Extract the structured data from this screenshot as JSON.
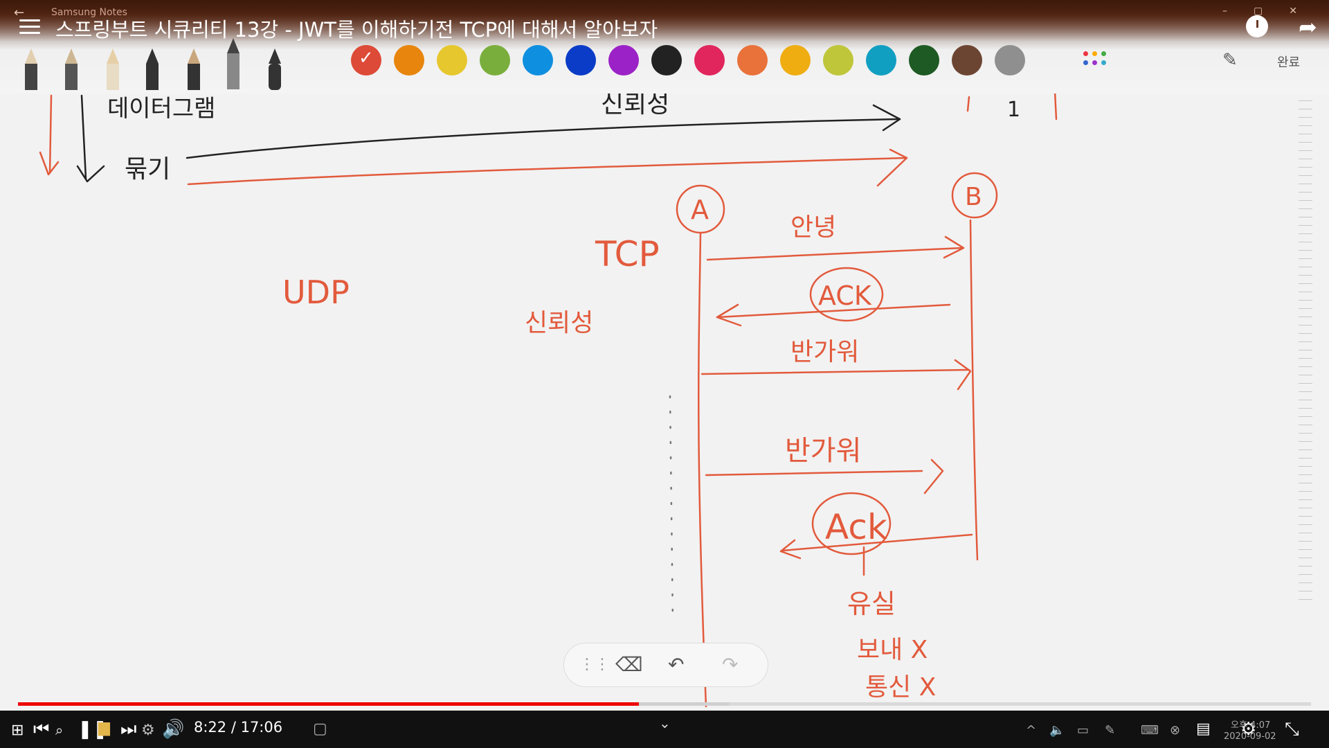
{
  "window": {
    "app_name": "Samsung Notes"
  },
  "video": {
    "title": "스프링부트 시큐리티 13강 - JWT를 이해하기전 TCP에 대해서 알아보자"
  },
  "toolbar": {
    "pens": [
      "pen-light",
      "pen-brush",
      "pen-pencil",
      "pen-fountain",
      "pen-ink",
      "pen-marker",
      "pen-custom"
    ],
    "colors": [
      "#dd4a37",
      "#e8850d",
      "#e6c72e",
      "#7aae3c",
      "#0f8fe0",
      "#0b3cc7",
      "#9b22c6",
      "#222222",
      "#e0265d",
      "#e9713a",
      "#efad12",
      "#bfc63a",
      "#109fc1",
      "#1e5a23",
      "#6c4532",
      "#8f8f8f"
    ],
    "more_colors_icon": "palette-dots-icon",
    "eyedropper_icon": "eyedropper-icon",
    "done_label": "완료"
  },
  "handwriting": {
    "datagram_note": "데이터그램",
    "reliability_note_top": "신뢰성",
    "one_mark": "1",
    "order_note": "묶기",
    "node_a": "A",
    "node_b": "B",
    "tcp_label": "TCP",
    "udp_label": "UDP",
    "reliability_note": "신뢰성",
    "greeting": "안녕",
    "ack_1": "ACK",
    "ack_2": "Ack",
    "reply_1": "반가워",
    "reply_2": "반가워",
    "loss_note": "유실",
    "resend_note": "보내 X",
    "send_note": "통신 X"
  },
  "note_tools": {
    "drag_icon": "drag-handle-icon",
    "eraser_icon": "eraser-icon",
    "undo_icon": "undo-icon",
    "redo_icon": "redo-icon"
  },
  "player": {
    "time_display": "8:22 / 17:06",
    "progress_fraction": 0.48,
    "buffer_fraction": 0.55
  },
  "taskbar": {
    "tray_time": "오후 4:07",
    "tray_date": "2020-09-02"
  }
}
